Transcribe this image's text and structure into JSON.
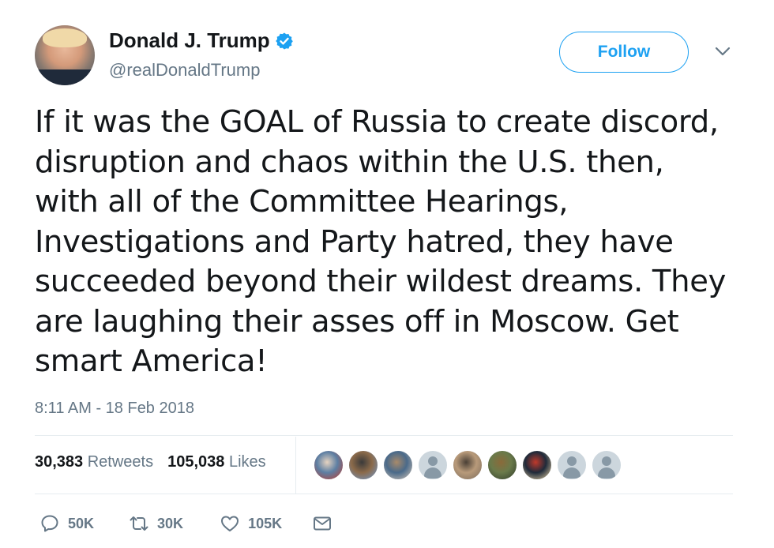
{
  "author": {
    "display_name": "Donald J. Trump",
    "handle": "@realDonaldTrump",
    "verified": true,
    "avatar_icon": "profile-photo"
  },
  "follow_button": {
    "label": "Follow"
  },
  "tweet": {
    "text": "If it was the GOAL of Russia to create discord,\ndisruption and chaos within the U.S. then,\nwith all of the Committee Hearings,\nInvestigations and Party hatred, they have\nsucceeded beyond their wildest dreams. They\nare laughing their asses off in Moscow. Get\nsmart America!",
    "timestamp": "8:11 AM - 18 Feb 2018"
  },
  "stats": {
    "retweets_count": "30,383",
    "retweets_label": "Retweets",
    "likes_count": "105,038",
    "likes_label": "Likes"
  },
  "likers": [
    {
      "kind": "photo",
      "colors": [
        "#c0392b",
        "#5d7fa3",
        "#e6d3c0"
      ]
    },
    {
      "kind": "photo",
      "colors": [
        "#6f9bd1",
        "#8b6a4a",
        "#3a3a3a"
      ]
    },
    {
      "kind": "photo",
      "colors": [
        "#d8c8b8",
        "#4a6a8a",
        "#a88a6a"
      ]
    },
    {
      "kind": "default"
    },
    {
      "kind": "photo",
      "colors": [
        "#7a6a5a",
        "#b89a7a",
        "#4a4036"
      ]
    },
    {
      "kind": "photo",
      "colors": [
        "#2f3a2a",
        "#6a7a4a",
        "#8a6a3a"
      ]
    },
    {
      "kind": "photo",
      "colors": [
        "#f0d9a8",
        "#1f2a3a",
        "#c0392b"
      ]
    },
    {
      "kind": "default"
    },
    {
      "kind": "default"
    }
  ],
  "actions": {
    "reply_count": "50K",
    "retweet_count": "30K",
    "like_count": "105K"
  },
  "colors": {
    "accent": "#1da1f2",
    "secondary_text": "#657786",
    "primary_text": "#14171a",
    "divider": "#e6ecf0"
  }
}
